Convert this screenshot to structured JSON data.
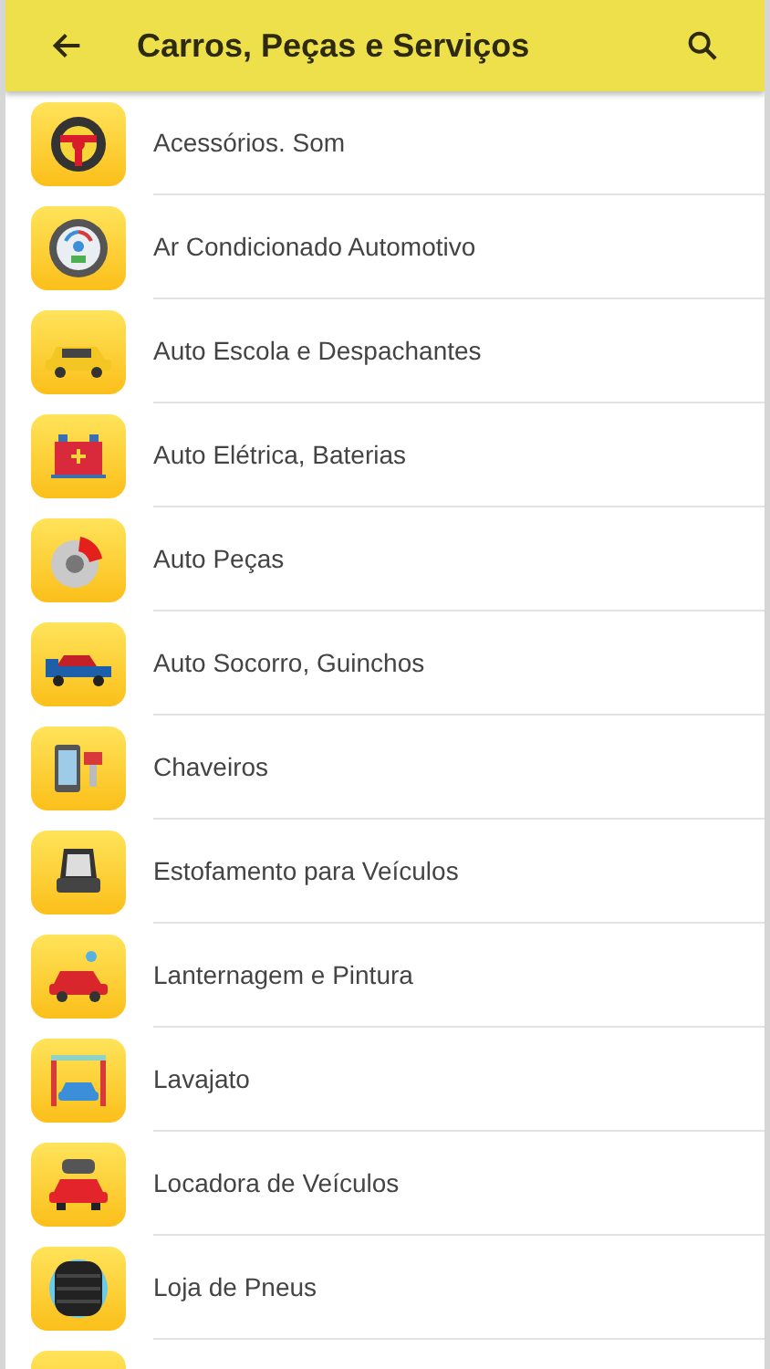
{
  "app_bar": {
    "title": "Carros, Peças e Serviços"
  },
  "categories": [
    {
      "kind": "steering",
      "label": "Acessórios. Som"
    },
    {
      "kind": "gauge",
      "label": "Ar Condicionado Automotivo"
    },
    {
      "kind": "taxi",
      "label": "Auto Escola e Despachantes"
    },
    {
      "kind": "battery",
      "label": "Auto Elétrica, Baterias"
    },
    {
      "kind": "brake",
      "label": "Auto Peças"
    },
    {
      "kind": "truck",
      "label": "Auto Socorro, Guinchos"
    },
    {
      "kind": "key",
      "label": "Chaveiros"
    },
    {
      "kind": "seat",
      "label": "Estofamento para Veículos"
    },
    {
      "kind": "paint",
      "label": "Lanternagem e Pintura"
    },
    {
      "kind": "wash",
      "label": "Lavajato"
    },
    {
      "kind": "rental",
      "label": "Locadora de Veículos"
    },
    {
      "kind": "tire",
      "label": "Loja de Pneus"
    },
    {
      "kind": "partial"
    }
  ]
}
